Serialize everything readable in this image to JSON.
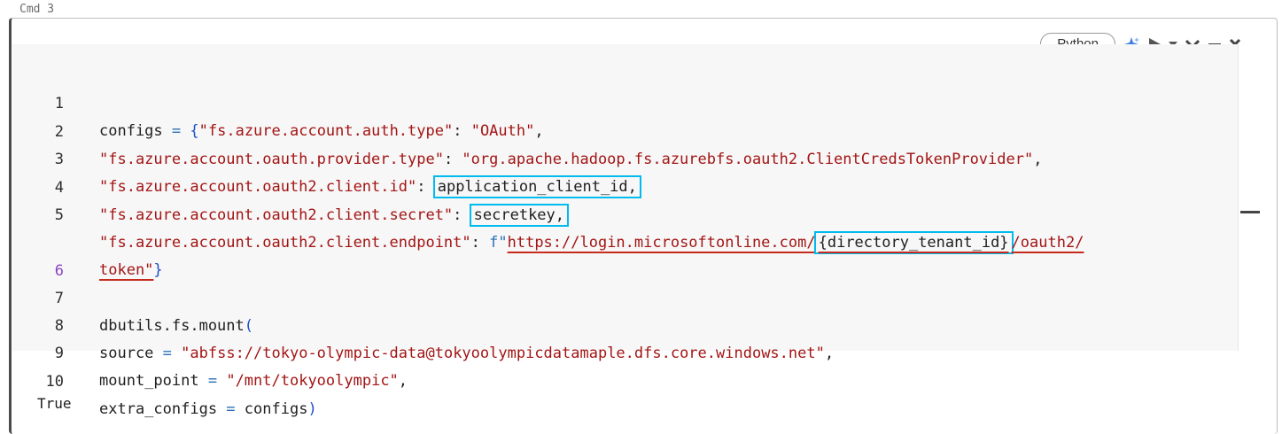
{
  "cmd_label": "Cmd 3",
  "toolbar": {
    "language": "Python",
    "icons": [
      "sparkle-icon",
      "run-icon",
      "run-dropdown-icon",
      "collapse-icon",
      "minimize-icon",
      "close-icon"
    ]
  },
  "code": {
    "lines": [
      {
        "n": "1",
        "parts": [
          "configs ",
          "=",
          " ",
          "{",
          "\"fs.azure.account.auth.type\"",
          ": ",
          "\"OAuth\"",
          ","
        ]
      },
      {
        "n": "2",
        "parts": [
          "\"fs.azure.account.oauth.provider.type\"",
          ": ",
          "\"org.apache.hadoop.fs.azurebfs.oauth2.ClientCredsTokenProvider\"",
          ","
        ]
      },
      {
        "n": "3",
        "parts": [
          "\"fs.azure.account.oauth2.client.id\"",
          ": ",
          "application_client_id,"
        ]
      },
      {
        "n": "4",
        "parts": [
          "\"fs.azure.account.oauth2.client.secret\"",
          ": ",
          "secretkey,"
        ]
      },
      {
        "n": "5",
        "parts": [
          "\"fs.azure.account.oauth2.client.endpoint\"",
          ": ",
          "f\"",
          "https://login.microsoftonline.com/",
          "{directory_tenant_id}",
          "/oauth2/"
        ]
      },
      {
        "n": "",
        "parts": [
          "token\"",
          "}"
        ]
      },
      {
        "n": "6",
        "parts": [
          ""
        ]
      },
      {
        "n": "7",
        "parts": [
          "dbutils.fs.mount",
          "("
        ]
      },
      {
        "n": "8",
        "parts": [
          "source ",
          "=",
          " ",
          "\"abfss://tokyo-olympic-data@tokyoolympicdatamaple.dfs.core.windows.net\"",
          ","
        ]
      },
      {
        "n": "9",
        "parts": [
          "mount_point ",
          "=",
          " ",
          "\"/mnt/tokyoolympic\"",
          ","
        ]
      },
      {
        "n": "10",
        "parts": [
          "extra_configs ",
          "=",
          " configs",
          ")"
        ]
      }
    ]
  },
  "output": "True",
  "colors": {
    "string": "#a31515",
    "highlight_box": "#00bcee",
    "active_line_number": "#8b44c4"
  }
}
